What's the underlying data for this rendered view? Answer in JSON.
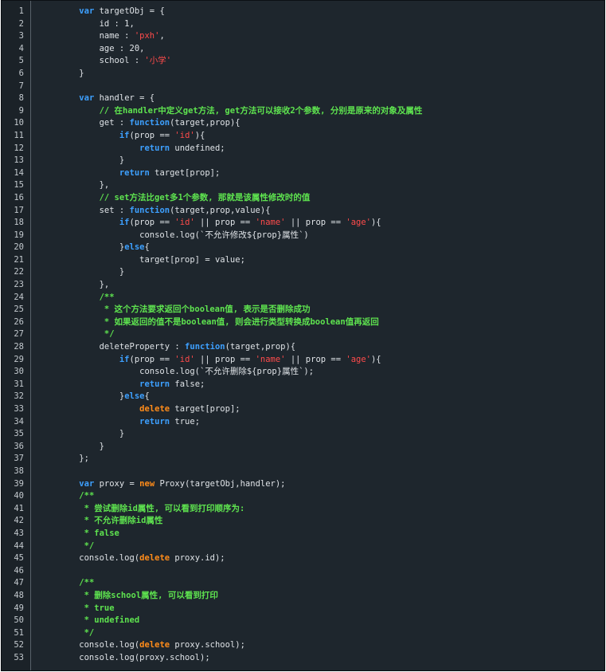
{
  "editor": {
    "colors": {
      "background": "#1e262d",
      "gutter": "#1b2228",
      "text": "#dfe3e7",
      "keyword": "#3da0ff",
      "keyword_alt": "#ff8c1a",
      "string": "#ff4b4b",
      "comment": "#5ee34f",
      "line_number": "#c3c9ce"
    },
    "lines": [
      {
        "n": "1",
        "tokens": [
          {
            "t": "    ",
            "c": "pl"
          },
          {
            "t": "var",
            "c": "kw"
          },
          {
            "t": " targetObj = {",
            "c": "pl"
          }
        ]
      },
      {
        "n": "2",
        "tokens": [
          {
            "t": "        id : 1,",
            "c": "pl"
          }
        ]
      },
      {
        "n": "3",
        "tokens": [
          {
            "t": "        name : ",
            "c": "pl"
          },
          {
            "t": "'pxh'",
            "c": "str"
          },
          {
            "t": ",",
            "c": "pl"
          }
        ]
      },
      {
        "n": "4",
        "tokens": [
          {
            "t": "        age : 20,",
            "c": "pl"
          }
        ]
      },
      {
        "n": "5",
        "tokens": [
          {
            "t": "        school : ",
            "c": "pl"
          },
          {
            "t": "'小学'",
            "c": "str"
          }
        ]
      },
      {
        "n": "6",
        "tokens": [
          {
            "t": "    }",
            "c": "pl"
          }
        ]
      },
      {
        "n": "7",
        "tokens": []
      },
      {
        "n": "8",
        "tokens": [
          {
            "t": "    ",
            "c": "pl"
          },
          {
            "t": "var",
            "c": "kw"
          },
          {
            "t": " handler = {",
            "c": "pl"
          }
        ]
      },
      {
        "n": "9",
        "tokens": [
          {
            "t": "        ",
            "c": "pl"
          },
          {
            "t": "// 在handler中定义get方法, get方法可以接收2个参数, 分别是原来的对象及属性",
            "c": "cm"
          }
        ]
      },
      {
        "n": "10",
        "tokens": [
          {
            "t": "        get : ",
            "c": "pl"
          },
          {
            "t": "function",
            "c": "kw"
          },
          {
            "t": "(target,prop){",
            "c": "pl"
          }
        ]
      },
      {
        "n": "11",
        "tokens": [
          {
            "t": "            ",
            "c": "pl"
          },
          {
            "t": "if",
            "c": "kw"
          },
          {
            "t": "(prop == ",
            "c": "pl"
          },
          {
            "t": "'id'",
            "c": "str"
          },
          {
            "t": "){",
            "c": "pl"
          }
        ]
      },
      {
        "n": "12",
        "tokens": [
          {
            "t": "                ",
            "c": "pl"
          },
          {
            "t": "return",
            "c": "kw"
          },
          {
            "t": " undefined;",
            "c": "pl"
          }
        ]
      },
      {
        "n": "13",
        "tokens": [
          {
            "t": "            }",
            "c": "pl"
          }
        ]
      },
      {
        "n": "14",
        "tokens": [
          {
            "t": "            ",
            "c": "pl"
          },
          {
            "t": "return",
            "c": "kw"
          },
          {
            "t": " target[prop];",
            "c": "pl"
          }
        ]
      },
      {
        "n": "15",
        "tokens": [
          {
            "t": "        },",
            "c": "pl"
          }
        ]
      },
      {
        "n": "16",
        "tokens": [
          {
            "t": "        ",
            "c": "pl"
          },
          {
            "t": "// set方法比get多1个参数, 那就是该属性修改时的值",
            "c": "cm"
          }
        ]
      },
      {
        "n": "17",
        "tokens": [
          {
            "t": "        set : ",
            "c": "pl"
          },
          {
            "t": "function",
            "c": "kw"
          },
          {
            "t": "(target,prop,value){",
            "c": "pl"
          }
        ]
      },
      {
        "n": "18",
        "tokens": [
          {
            "t": "            ",
            "c": "pl"
          },
          {
            "t": "if",
            "c": "kw"
          },
          {
            "t": "(prop == ",
            "c": "pl"
          },
          {
            "t": "'id'",
            "c": "str"
          },
          {
            "t": " || prop == ",
            "c": "pl"
          },
          {
            "t": "'name'",
            "c": "str"
          },
          {
            "t": " || prop == ",
            "c": "pl"
          },
          {
            "t": "'age'",
            "c": "str"
          },
          {
            "t": "){",
            "c": "pl"
          }
        ]
      },
      {
        "n": "19",
        "tokens": [
          {
            "t": "                console.log(`不允许修改${prop}属性`)",
            "c": "pl"
          }
        ]
      },
      {
        "n": "20",
        "tokens": [
          {
            "t": "            }",
            "c": "pl"
          },
          {
            "t": "else",
            "c": "kw"
          },
          {
            "t": "{",
            "c": "pl"
          }
        ]
      },
      {
        "n": "21",
        "tokens": [
          {
            "t": "                target[prop] = value;",
            "c": "pl"
          }
        ]
      },
      {
        "n": "22",
        "tokens": [
          {
            "t": "            }",
            "c": "pl"
          }
        ]
      },
      {
        "n": "23",
        "tokens": [
          {
            "t": "        },",
            "c": "pl"
          }
        ]
      },
      {
        "n": "24",
        "tokens": [
          {
            "t": "        ",
            "c": "pl"
          },
          {
            "t": "/**",
            "c": "cm"
          }
        ]
      },
      {
        "n": "25",
        "tokens": [
          {
            "t": "         ",
            "c": "pl"
          },
          {
            "t": "* 这个方法要求返回个boolean值, 表示是否删除成功",
            "c": "cm"
          }
        ]
      },
      {
        "n": "26",
        "tokens": [
          {
            "t": "         ",
            "c": "pl"
          },
          {
            "t": "* 如果返回的值不是boolean值, 则会进行类型转换成boolean值再返回",
            "c": "cm"
          }
        ]
      },
      {
        "n": "27",
        "tokens": [
          {
            "t": "         ",
            "c": "pl"
          },
          {
            "t": "*/",
            "c": "cm"
          }
        ]
      },
      {
        "n": "28",
        "tokens": [
          {
            "t": "        deleteProperty : ",
            "c": "pl"
          },
          {
            "t": "function",
            "c": "kw"
          },
          {
            "t": "(target,prop){",
            "c": "pl"
          }
        ]
      },
      {
        "n": "29",
        "tokens": [
          {
            "t": "            ",
            "c": "pl"
          },
          {
            "t": "if",
            "c": "kw"
          },
          {
            "t": "(prop == ",
            "c": "pl"
          },
          {
            "t": "'id'",
            "c": "str"
          },
          {
            "t": " || prop == ",
            "c": "pl"
          },
          {
            "t": "'name'",
            "c": "str"
          },
          {
            "t": " || prop == ",
            "c": "pl"
          },
          {
            "t": "'age'",
            "c": "str"
          },
          {
            "t": "){",
            "c": "pl"
          }
        ]
      },
      {
        "n": "30",
        "tokens": [
          {
            "t": "                console.log(`不允许删除${prop}属性`);",
            "c": "pl"
          }
        ]
      },
      {
        "n": "31",
        "tokens": [
          {
            "t": "                ",
            "c": "pl"
          },
          {
            "t": "return",
            "c": "kw"
          },
          {
            "t": " false;",
            "c": "pl"
          }
        ]
      },
      {
        "n": "32",
        "tokens": [
          {
            "t": "            }",
            "c": "pl"
          },
          {
            "t": "else",
            "c": "kw"
          },
          {
            "t": "{",
            "c": "pl"
          }
        ]
      },
      {
        "n": "33",
        "tokens": [
          {
            "t": "                ",
            "c": "pl"
          },
          {
            "t": "delete",
            "c": "kw2"
          },
          {
            "t": " target[prop];",
            "c": "pl"
          }
        ]
      },
      {
        "n": "34",
        "tokens": [
          {
            "t": "                ",
            "c": "pl"
          },
          {
            "t": "return",
            "c": "kw"
          },
          {
            "t": " true;",
            "c": "pl"
          }
        ]
      },
      {
        "n": "35",
        "tokens": [
          {
            "t": "            }",
            "c": "pl"
          }
        ]
      },
      {
        "n": "36",
        "tokens": [
          {
            "t": "        }",
            "c": "pl"
          }
        ]
      },
      {
        "n": "37",
        "tokens": [
          {
            "t": "    };",
            "c": "pl"
          }
        ]
      },
      {
        "n": "38",
        "tokens": []
      },
      {
        "n": "39",
        "tokens": [
          {
            "t": "    ",
            "c": "pl"
          },
          {
            "t": "var",
            "c": "kw"
          },
          {
            "t": " proxy = ",
            "c": "pl"
          },
          {
            "t": "new",
            "c": "kw2"
          },
          {
            "t": " Proxy(targetObj,handler);",
            "c": "pl"
          }
        ]
      },
      {
        "n": "40",
        "tokens": [
          {
            "t": "    ",
            "c": "pl"
          },
          {
            "t": "/**",
            "c": "cm"
          }
        ]
      },
      {
        "n": "41",
        "tokens": [
          {
            "t": "     ",
            "c": "pl"
          },
          {
            "t": "* 尝试删除id属性, 可以看到打印顺序为:",
            "c": "cm"
          }
        ]
      },
      {
        "n": "42",
        "tokens": [
          {
            "t": "     ",
            "c": "pl"
          },
          {
            "t": "* 不允许删除id属性",
            "c": "cm"
          }
        ]
      },
      {
        "n": "43",
        "tokens": [
          {
            "t": "     ",
            "c": "pl"
          },
          {
            "t": "* false",
            "c": "cm"
          }
        ]
      },
      {
        "n": "44",
        "tokens": [
          {
            "t": "     ",
            "c": "pl"
          },
          {
            "t": "*/",
            "c": "cm"
          }
        ]
      },
      {
        "n": "45",
        "tokens": [
          {
            "t": "    console.log(",
            "c": "pl"
          },
          {
            "t": "delete",
            "c": "kw2"
          },
          {
            "t": " proxy.id);",
            "c": "pl"
          }
        ]
      },
      {
        "n": "46",
        "tokens": []
      },
      {
        "n": "47",
        "tokens": [
          {
            "t": "    ",
            "c": "pl"
          },
          {
            "t": "/**",
            "c": "cm"
          }
        ]
      },
      {
        "n": "48",
        "tokens": [
          {
            "t": "     ",
            "c": "pl"
          },
          {
            "t": "* 删除school属性, 可以看到打印",
            "c": "cm"
          }
        ]
      },
      {
        "n": "49",
        "tokens": [
          {
            "t": "     ",
            "c": "pl"
          },
          {
            "t": "* true",
            "c": "cm"
          }
        ]
      },
      {
        "n": "50",
        "tokens": [
          {
            "t": "     ",
            "c": "pl"
          },
          {
            "t": "* undefined",
            "c": "cm"
          }
        ]
      },
      {
        "n": "51",
        "tokens": [
          {
            "t": "     ",
            "c": "pl"
          },
          {
            "t": "*/",
            "c": "cm"
          }
        ]
      },
      {
        "n": "52",
        "tokens": [
          {
            "t": "    console.log(",
            "c": "pl"
          },
          {
            "t": "delete",
            "c": "kw2"
          },
          {
            "t": " proxy.school);",
            "c": "pl"
          }
        ]
      },
      {
        "n": "53",
        "tokens": [
          {
            "t": "    console.log(proxy.school);",
            "c": "pl"
          }
        ]
      }
    ]
  }
}
